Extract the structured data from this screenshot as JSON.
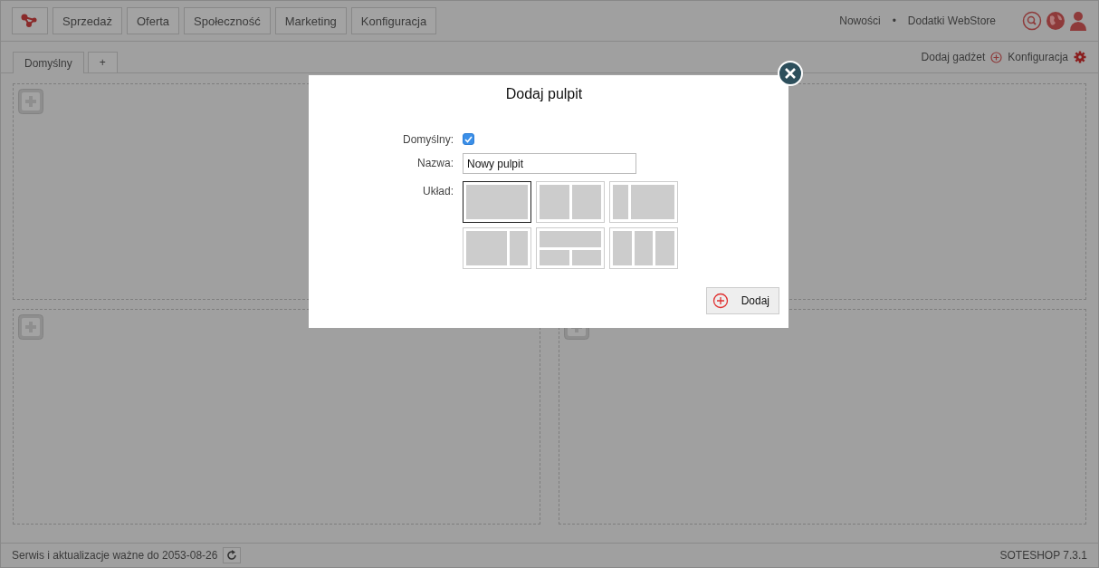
{
  "top_nav": {
    "menu": [
      {
        "label": "Sprzedaż"
      },
      {
        "label": "Oferta"
      },
      {
        "label": "Społeczność"
      },
      {
        "label": "Marketing"
      },
      {
        "label": "Konfiguracja"
      }
    ],
    "links": [
      "Nowości",
      "Dodatki WebStore"
    ],
    "separator": "•"
  },
  "tabs": [
    {
      "label": "Domyślny",
      "selected": true
    },
    {
      "label": "+",
      "selected": false
    }
  ],
  "toolbar": {
    "add_gadget": "Dodaj gadżet",
    "configuration": "Konfiguracja"
  },
  "dashboard": {
    "panels": [
      {
        "kind": "slot"
      },
      {
        "kind": "plain"
      },
      {
        "kind": "slot"
      },
      {
        "kind": "slot"
      }
    ]
  },
  "dialog": {
    "title": "Dodaj pulpit",
    "default_label": "Domyślny:",
    "default_checked": true,
    "name_label": "Nazwa:",
    "name_value": "Nowy pulpit",
    "layout_label": "Układ:",
    "layouts": [
      {
        "kind": "full",
        "selected": true
      },
      {
        "kind": "half-half",
        "selected": false
      },
      {
        "kind": "narrow-wide",
        "selected": false
      },
      {
        "kind": "wide-narrow",
        "selected": false
      },
      {
        "kind": "top-two",
        "selected": false
      },
      {
        "kind": "three",
        "selected": false
      }
    ],
    "add_button": "Dodaj"
  },
  "status_bar": {
    "service": "Serwis i aktualizacje ważne do 2053-08-26",
    "version": "SOTESHOP 7.3.1"
  }
}
